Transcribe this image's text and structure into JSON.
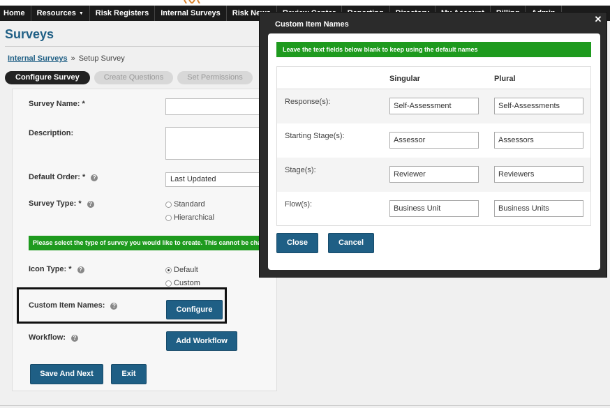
{
  "nav": {
    "items": [
      {
        "label": "Home"
      },
      {
        "label": "Resources",
        "has_caret": true
      },
      {
        "label": "Risk Registers"
      },
      {
        "label": "Internal Surveys"
      },
      {
        "label": "Risk News"
      },
      {
        "label": "Review Center"
      },
      {
        "label": "Reporting"
      },
      {
        "label": "Directory"
      },
      {
        "label": "My Account"
      },
      {
        "label": "Billing"
      },
      {
        "label": "Admin"
      }
    ]
  },
  "page": {
    "title": "Surveys",
    "breadcrumb": {
      "link": "Internal Surveys",
      "separator": "»",
      "current": "Setup Survey"
    },
    "steps": [
      {
        "label": "Configure Survey",
        "active": true
      },
      {
        "label": "Create Questions",
        "active": false
      },
      {
        "label": "Set Permissions",
        "active": false
      }
    ]
  },
  "form": {
    "survey_name_label": "Survey Name:",
    "required_mark": "*",
    "description_label": "Description:",
    "default_order_label": "Default Order:",
    "default_order_value": "Last Updated",
    "survey_type_label": "Survey Type:",
    "survey_type_options": [
      "Standard",
      "Hierarchical"
    ],
    "survey_type_note": "Please select the type of survey you would like to create. This cannot be changed later.",
    "icon_type_label": "Icon Type:",
    "icon_type_options": [
      "Default",
      "Custom"
    ],
    "custom_item_names_label": "Custom Item Names:",
    "configure_label": "Configure",
    "workflow_label": "Workflow:",
    "add_workflow_label": "Add Workflow",
    "save_next_label": "Save And Next",
    "exit_label": "Exit",
    "help_glyph": "?"
  },
  "modal": {
    "title": "Custom Item Names",
    "close_glyph": "✕",
    "note": "Leave the text fields below blank to keep using the default names",
    "col_singular": "Singular",
    "col_plural": "Plural",
    "rows": [
      {
        "label": "Response(s):",
        "singular": "Self-Assessment",
        "plural": "Self-Assessments"
      },
      {
        "label": "Starting Stage(s):",
        "singular": "Assessor",
        "plural": "Assessors"
      },
      {
        "label": "Stage(s):",
        "singular": "Reviewer",
        "plural": "Reviewers"
      },
      {
        "label": "Flow(s):",
        "singular": "Business Unit",
        "plural": "Business Units"
      }
    ],
    "close_label": "Close",
    "cancel_label": "Cancel"
  },
  "colors": {
    "nav_bg": "#1b1b1b",
    "primary_button": "#1f5f85",
    "success_green": "#1e9a1e",
    "modal_frame": "#2b2b2b"
  }
}
